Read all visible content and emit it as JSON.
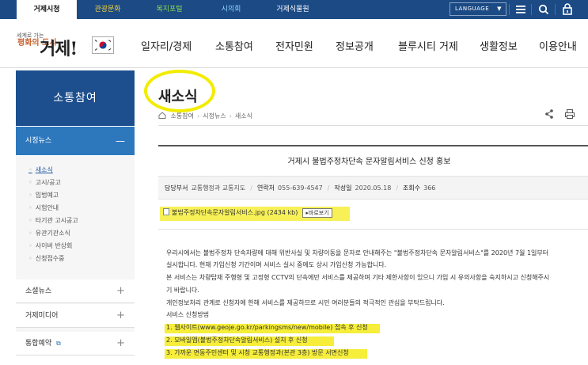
{
  "topbar": {
    "tabs": [
      {
        "label": "거제시청",
        "color": "#111111"
      },
      {
        "label": "관광문화",
        "color": "#f4d23a"
      },
      {
        "label": "복지포털",
        "color": "#8fd94b"
      },
      {
        "label": "시의회",
        "color": "#8fd6ff"
      },
      {
        "label": "거제식물원",
        "color": "#ffffff"
      }
    ],
    "language_label": "LANGUAGE",
    "icons": [
      "menu-icon",
      "search-icon",
      "lock-icon"
    ]
  },
  "header": {
    "logo_slogan_small": "세계로 가는",
    "logo_slogan_big": "평화의 도시",
    "logo_name": "거제!",
    "gnb": [
      "일자리/경제",
      "소통참여",
      "전자민원",
      "정보공개",
      "블루시티 거제",
      "생활정보",
      "이용안내"
    ]
  },
  "sidebar": {
    "title": "소통참여",
    "active_section": "시정뉴스",
    "sub_items": [
      "새소식",
      "고시/공고",
      "입법예고",
      "시험안내",
      "타기관 고시공고",
      "유관기관소식",
      "사이버 반상회",
      "신청접수중"
    ],
    "sections": [
      {
        "label": "소셜뉴스"
      },
      {
        "label": "거제미디어"
      },
      {
        "label": "통합예약"
      }
    ]
  },
  "content": {
    "page_title": "새소식",
    "breadcrumb": [
      "소통참여",
      "시정뉴스",
      "새소식"
    ],
    "post_title": "거제시 불법주정차단속 문자알림서비스 신청 홍보",
    "meta": {
      "dept_label": "담당부서",
      "dept_value": "교통행정과 교통지도",
      "contact_label": "연락처",
      "contact_value": "055-639-4547",
      "date_label": "작성일",
      "date_value": "2020.05.18",
      "views_label": "조회수",
      "views_value": "366"
    },
    "attachment": {
      "filename": "불법주정차단속문자알림서비스.jpg (2434 kb)",
      "view_button": "바로보기"
    },
    "body_lines": [
      "우리시에서는 불법주정차 단속차량에 대해 위반사실 및 차량이동을 문자로 안내해주는 \"불법주정차단속 문자알림서비스\"를 2020년 7월 1일부터",
      "실시합니다. 현재 가입신청 기간이며 서비스 실시 중에도 상시 가입신청 가능합니다.",
      "본 서비스는 차량탑재 주행형 및 고정형 CCTV의 단속에만 서비스를 제공하며 기타 제한사항이 있으니 가입 시 유의사항을 숙지하시고 신청해주시",
      "기 바랍니다.",
      "개인정보처리 관계로 신청자에 한해 서비스를 제공하므로 시민 여러분들의 적극적인 관심을 부탁드립니다.",
      "서비스 신청방법"
    ],
    "steps": [
      {
        "prefix": "1. ",
        "link": "웹사이트(www.geoje.go.kr/parkingsms/new/mobile)",
        "suffix": " 접속 후 신청"
      },
      {
        "prefix": "2. ",
        "link": "모바일앱(불법주정차단속알림서비스)",
        "suffix": " 설치 후 신청"
      },
      {
        "prefix": "3. ",
        "link": "",
        "suffix": "가까운 면동주민센터 및 시청 교통행정과(본관 3층) 방문 서면신청"
      }
    ],
    "highlight_color": "#f6ee3a"
  }
}
